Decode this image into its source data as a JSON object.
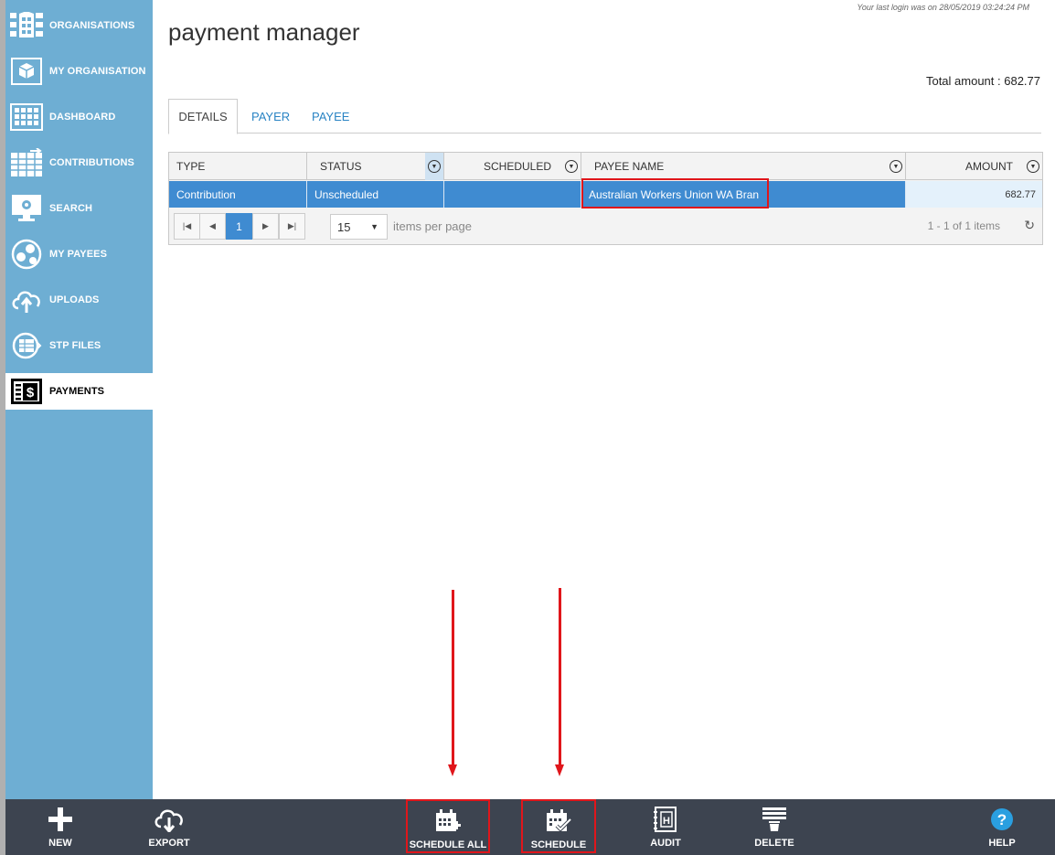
{
  "header": {
    "last_login": "Your last login was on 28/05/2019 03:24:24 PM",
    "title": "payment manager",
    "total_amount": "Total amount : 682.77"
  },
  "sidebar": {
    "items": [
      {
        "label": "ORGANISATIONS",
        "icon": "organisations-icon"
      },
      {
        "label": "MY ORGANISATION",
        "icon": "organisation-cube-icon"
      },
      {
        "label": "DASHBOARD",
        "icon": "dashboard-icon"
      },
      {
        "label": "CONTRIBUTIONS",
        "icon": "contributions-icon"
      },
      {
        "label": "SEARCH",
        "icon": "search-monitor-icon"
      },
      {
        "label": "MY PAYEES",
        "icon": "payees-icon"
      },
      {
        "label": "UPLOADS",
        "icon": "cloud-upload-icon"
      },
      {
        "label": "STP FILES",
        "icon": "stp-files-icon"
      },
      {
        "label": "PAYMENTS",
        "icon": "payments-icon",
        "active": true
      }
    ]
  },
  "tabs": [
    {
      "label": "DETAILS",
      "active": true
    },
    {
      "label": "PAYER"
    },
    {
      "label": "PAYEE"
    }
  ],
  "grid": {
    "columns": [
      "TYPE",
      "STATUS",
      "SCHEDULED",
      "PAYEE NAME",
      "AMOUNT"
    ],
    "rows": [
      {
        "type": "Contribution",
        "status": "Unscheduled",
        "scheduled": "",
        "payee_name": "Australian Workers Union WA Bran",
        "amount": "682.77"
      }
    ],
    "pager": {
      "current_page": "1",
      "page_size": "15",
      "items_per_page_label": "items per page",
      "info": "1 - 1 of 1 items"
    }
  },
  "toolbar": {
    "buttons": [
      {
        "label": "NEW",
        "icon": "plus-icon"
      },
      {
        "label": "EXPORT",
        "icon": "cloud-download-icon"
      },
      {
        "label": "SCHEDULE ALL",
        "icon": "calendar-add-icon"
      },
      {
        "label": "SCHEDULE",
        "icon": "calendar-check-icon"
      },
      {
        "label": "AUDIT",
        "icon": "audit-book-icon"
      },
      {
        "label": "DELETE",
        "icon": "delete-bin-icon"
      },
      {
        "label": "HELP",
        "icon": "help-icon"
      }
    ]
  },
  "colors": {
    "sidebar": "#6eaed3",
    "selected_row": "#3f8bd1",
    "highlight": "#e0161b",
    "toolbar": "#3d4450",
    "help_icon": "#2a9fe0"
  }
}
